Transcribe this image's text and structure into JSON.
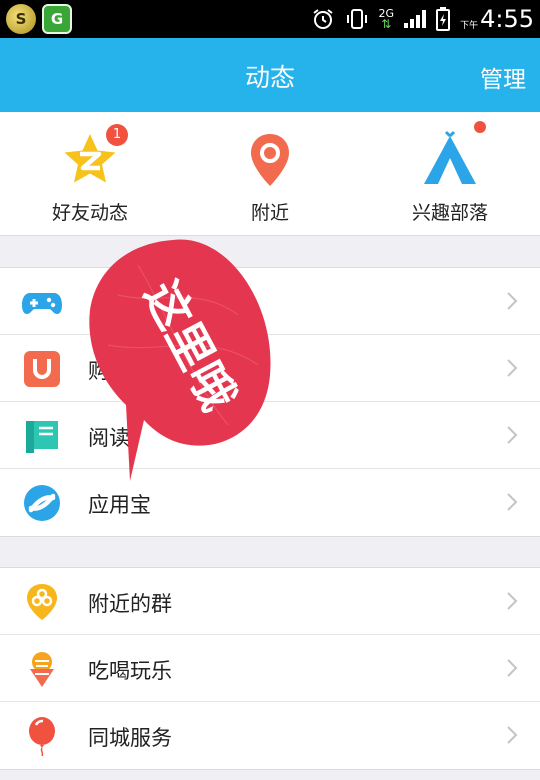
{
  "status_bar": {
    "network": "2G",
    "ampm": "下午",
    "time": "4:55"
  },
  "header": {
    "title": "动态",
    "manage_label": "管理"
  },
  "quick_actions": [
    {
      "label": "好友动态",
      "icon": "qzone-star-icon",
      "badge": "1"
    },
    {
      "label": "附近",
      "icon": "location-pin-icon"
    },
    {
      "label": "兴趣部落",
      "icon": "tent-icon",
      "has_dot": true
    }
  ],
  "group1": [
    {
      "label": "",
      "icon": "gamepad-icon"
    },
    {
      "label": "购",
      "icon": "shopping-magnet-icon"
    },
    {
      "label": "阅读",
      "icon": "book-icon"
    },
    {
      "label": "应用宝",
      "icon": "app-store-icon"
    }
  ],
  "group2": [
    {
      "label": "附近的群",
      "icon": "nearby-group-icon"
    },
    {
      "label": "吃喝玩乐",
      "icon": "ice-cream-icon"
    },
    {
      "label": "同城服务",
      "icon": "balloon-icon"
    }
  ],
  "sticker": {
    "text": "这里哦"
  },
  "colors": {
    "header_bg": "#26b2ea",
    "badge_red": "#f0523f",
    "sticker_red": "#e4364f"
  }
}
